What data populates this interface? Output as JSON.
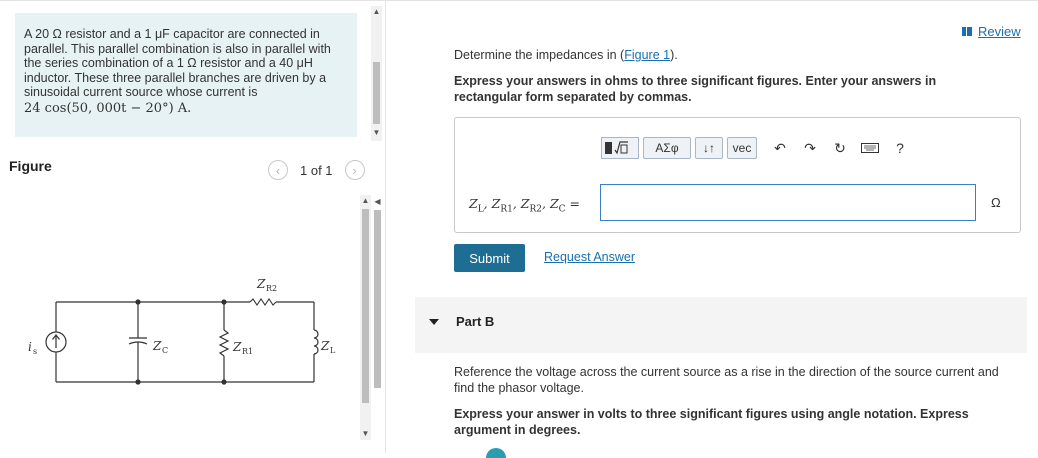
{
  "problem": {
    "line1": "A 20 Ω resistor and a 1 μF capacitor are connected in",
    "line2": "parallel. This parallel combination is also in parallel with",
    "line3": "the series combination of a 1 Ω resistor and a 40 μH",
    "line4": "inductor. These three parallel branches are driven by a",
    "line5": "sinusoidal current source whose current is",
    "math": "24 cos(50, 000t − 20°) A."
  },
  "figure": {
    "heading": "Figure",
    "pager": "1 of 1",
    "labels": {
      "is": "i",
      "is_sub": "s",
      "zc": "Z",
      "zc_sub": "C",
      "zr1": "Z",
      "zr1_sub": "R1",
      "zr2": "Z",
      "zr2_sub": "R2",
      "zl": "Z",
      "zl_sub": "L"
    }
  },
  "review": "Review",
  "instructions": {
    "determine_pre": "Determine the impedances in (",
    "determine_link": "Figure 1",
    "determine_post": ").",
    "express_1": "Express your answers in ohms to three significant figures. Enter your answers in",
    "express_2": "rectangular form separated by commas."
  },
  "toolbar": {
    "greek": "ΑΣφ",
    "updown": "↓↑",
    "vec": "vec",
    "help": "?"
  },
  "answer": {
    "label_z": "Z",
    "sub_l": "L",
    "sub_r1": "R1",
    "sub_r2": "R2",
    "sub_c": "C",
    "sep": ", ",
    "eq": " =",
    "value": "",
    "unit": "Ω"
  },
  "buttons": {
    "submit": "Submit",
    "request": "Request Answer"
  },
  "partB": {
    "label": "Part B",
    "text1": "Reference the voltage across the current source as a rise in the direction of the source current and",
    "text2": "find the phasor voltage.",
    "express1": "Express your answer in volts to three significant figures using angle notation. Express",
    "express2": "argument in degrees."
  }
}
